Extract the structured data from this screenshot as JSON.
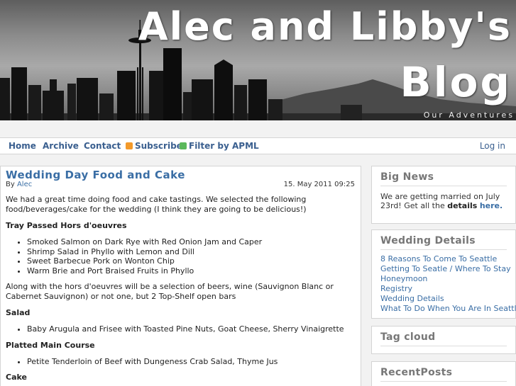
{
  "header": {
    "title_line1": "Alec and Libby's",
    "title_line2": "Blog",
    "tagline": "Our Adventures"
  },
  "nav": {
    "items": [
      {
        "label": "Home"
      },
      {
        "label": "Archive"
      },
      {
        "label": "Contact"
      },
      {
        "label": "Subscribe",
        "icon": "rss-icon",
        "icon_color": "#f39a2b"
      },
      {
        "label": "Filter by APML",
        "icon": "apml-icon",
        "icon_color": "#5bb85b"
      }
    ],
    "login": "Log in"
  },
  "post": {
    "title": "Wedding Day Food and Cake",
    "by_prefix": "By",
    "author": "Alec",
    "date": "15. May 2011 09:25",
    "intro": "We had a great time doing food and cake tastings. We selected the following food/beverages/cake for the wedding (I think they are going to be delicious!)",
    "sections": [
      {
        "heading": "Tray Passed Hors d'oeuvres",
        "items": [
          "Smoked Salmon on Dark Rye with Red Onion Jam and Caper",
          "Shrimp Salad in Phyllo with Lemon and Dill",
          "Sweet Barbecue Pork on Wonton Chip",
          "Warm Brie and Port Braised Fruits in Phyllo"
        ],
        "after": "Along with the hors d'oeuvres will be a selection of beers, wine (Sauvignon Blanc or Cabernet Sauvignon) or not one, but 2 Top-Shelf open bars"
      },
      {
        "heading": "Salad",
        "items": [
          "Baby Arugula and Frisee with Toasted Pine Nuts, Goat Cheese, Sherry Vinaigrette"
        ]
      },
      {
        "heading": "Platted Main Course",
        "items": [
          "Petite Tenderloin of Beef with Dungeness Crab Salad, Thyme Jus"
        ]
      },
      {
        "heading": "Cake",
        "items": []
      }
    ]
  },
  "sidebar": {
    "big_news": {
      "title": "Big News",
      "text_before": "We are getting married on July 23rd! Get all the",
      "details_bold": "details",
      "here_link": "here."
    },
    "wedding_details": {
      "title": "Wedding Details",
      "links": [
        "8 Reasons To Come To Seattle",
        "Getting To Seatle / Where To Stay",
        "Honeymoon",
        "Registry",
        "Wedding Details",
        "What To Do When You Are In Seattle"
      ]
    },
    "tag_cloud": {
      "title": "Tag cloud"
    },
    "recent_posts": {
      "title": "RecentPosts"
    }
  }
}
